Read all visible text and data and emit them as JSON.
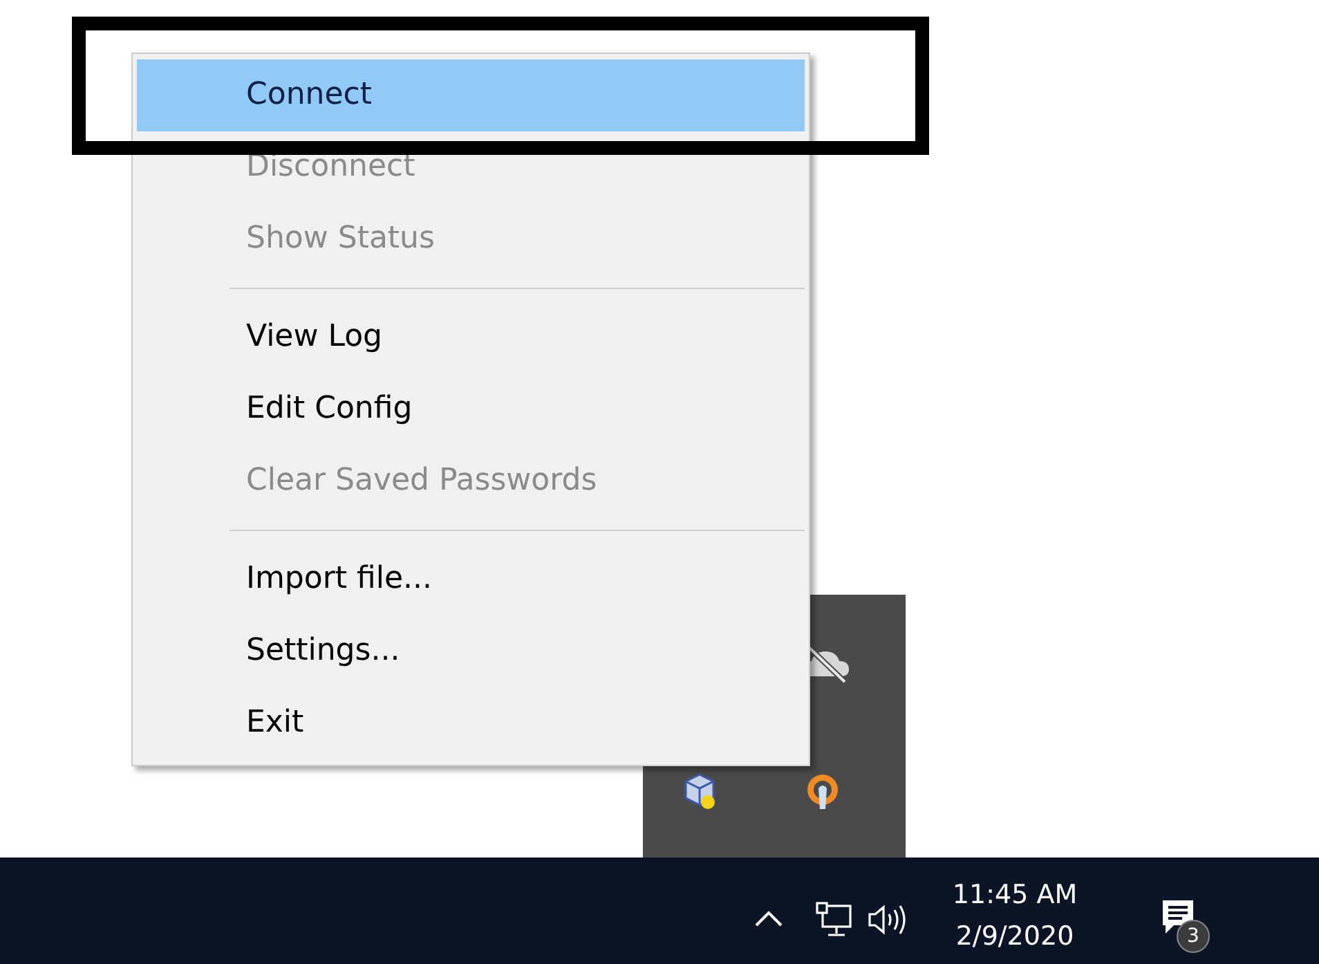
{
  "context_menu": {
    "sections": [
      [
        {
          "label": "Connect",
          "selected": true,
          "disabled": false
        },
        {
          "label": "Disconnect",
          "selected": false,
          "disabled": true
        },
        {
          "label": "Show Status",
          "selected": false,
          "disabled": true
        }
      ],
      [
        {
          "label": "View Log",
          "selected": false,
          "disabled": false
        },
        {
          "label": "Edit Config",
          "selected": false,
          "disabled": false
        },
        {
          "label": "Clear Saved Passwords",
          "selected": false,
          "disabled": true
        }
      ],
      [
        {
          "label": "Import file...",
          "selected": false,
          "disabled": false
        },
        {
          "label": "Settings...",
          "selected": false,
          "disabled": false
        },
        {
          "label": "Exit",
          "selected": false,
          "disabled": false
        }
      ]
    ]
  },
  "taskbar": {
    "time": "11:45 AM",
    "date": "2/9/2020",
    "notification_count": "3"
  }
}
